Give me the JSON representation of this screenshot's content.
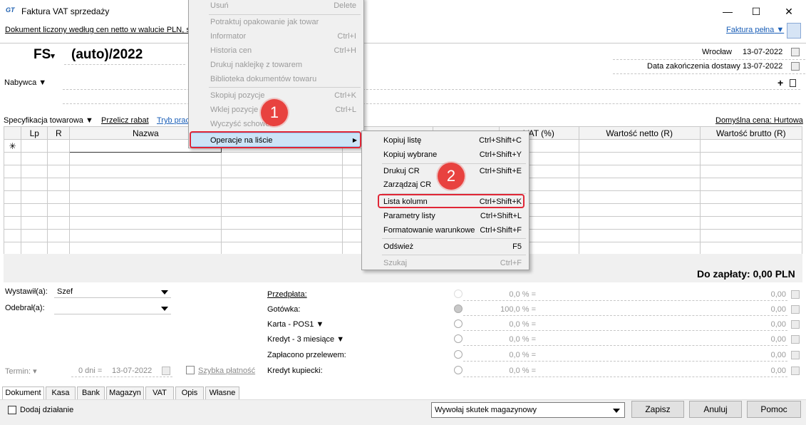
{
  "window": {
    "title": "Faktura VAT sprzedaży",
    "subtitle": "Dokument liczony według cen netto w walucie PLN, sp",
    "faktura_link": "Faktura pełna"
  },
  "header": {
    "doc_type": "FS",
    "doc_number": "(auto)/2022",
    "city": "Wrocław",
    "date": "13-07-2022",
    "delivery_label": "Data zakończenia dostawy",
    "delivery_date": "13-07-2022",
    "buyer_label": "Nabywca"
  },
  "toolbar": {
    "spec_label": "Specyfikacja towarowa",
    "recalc_label": "Przelicz rabat",
    "mode_label": "Tryb prac",
    "default_price": "Domyślna cena: Hurtowa"
  },
  "table": {
    "columns": [
      "Lp",
      "R",
      "Nazwa",
      "VAT (%)",
      "Wartość netto (R)",
      "Wartość brutto (R)"
    ],
    "new_row_marker": "✳"
  },
  "totals": {
    "to_pay": "Do zapłaty: 0,00 PLN"
  },
  "bottom": {
    "issued_label": "Wystawił(a):",
    "issued_value": "Szef",
    "received_label": "Odebrał(a):",
    "term_label": "Termin:",
    "term_days": "0 dni =",
    "term_date": "13-07-2022",
    "quick_pay": "Szybka płatność",
    "payments": [
      {
        "label": "Przedpłata:",
        "pct": "0,0 % =",
        "amount": "0,00"
      },
      {
        "label": "Gotówka:",
        "pct": "100,0 % =",
        "amount": "0,00"
      },
      {
        "label": "Karta - POS1",
        "pct": "0,0 % =",
        "amount": "0,00"
      },
      {
        "label": "Kredyt - 3 miesiące",
        "pct": "0,0 % =",
        "amount": "0,00"
      },
      {
        "label": "Zapłacono przelewem:",
        "pct": "0,0 % =",
        "amount": "0,00"
      },
      {
        "label": "Kredyt kupiecki:",
        "pct": "0,0 % =",
        "amount": "0,00"
      }
    ]
  },
  "tabs": [
    "Dokument",
    "Kasa",
    "Bank",
    "Magazyn",
    "VAT",
    "Opis",
    "Własne"
  ],
  "footer": {
    "add_action": "Dodaj działanie",
    "warehouse_select": "Wywołaj skutek magazynowy",
    "save": "Zapisz",
    "cancel": "Anuluj",
    "help": "Pomoc"
  },
  "context_menu": {
    "items": [
      {
        "label": "Usuń",
        "shortcut": "Delete"
      },
      {
        "label": "Potraktuj opakowanie jak towar",
        "shortcut": ""
      },
      {
        "label": "Informator",
        "shortcut": "Ctrl+I"
      },
      {
        "label": "Historia cen",
        "shortcut": "Ctrl+H"
      },
      {
        "label": "Drukuj naklejkę z towarem",
        "shortcut": ""
      },
      {
        "label": "Biblioteka dokumentów towaru",
        "shortcut": ""
      },
      {
        "label": "Skopiuj pozycje",
        "shortcut": "Ctrl+K"
      },
      {
        "label": "Wklej pozycje",
        "shortcut": "Ctrl+L"
      },
      {
        "label": "Wyczyść schowek",
        "shortcut": ""
      },
      {
        "label": "Operacje na liście",
        "shortcut": ""
      }
    ]
  },
  "submenu": {
    "items": [
      {
        "label": "Kopiuj listę",
        "shortcut": "Ctrl+Shift+C"
      },
      {
        "label": "Kopiuj wybrane",
        "shortcut": "Ctrl+Shift+Y"
      },
      {
        "label": "Drukuj CR",
        "shortcut": "Ctrl+Shift+E"
      },
      {
        "label": "Zarządzaj CR",
        "shortcut": ""
      },
      {
        "label": "Lista kolumn",
        "shortcut": "Ctrl+Shift+K"
      },
      {
        "label": "Parametry listy",
        "shortcut": "Ctrl+Shift+L"
      },
      {
        "label": "Formatowanie warunkowe",
        "shortcut": "Ctrl+Shift+F"
      },
      {
        "label": "Odśwież",
        "shortcut": "F5"
      },
      {
        "label": "Szukaj",
        "shortcut": "Ctrl+F"
      }
    ]
  },
  "badges": [
    "1",
    "2"
  ],
  "colors": {
    "accent": "#1b5fb7",
    "highlight": "#e02636",
    "badge": "#e8423f"
  }
}
